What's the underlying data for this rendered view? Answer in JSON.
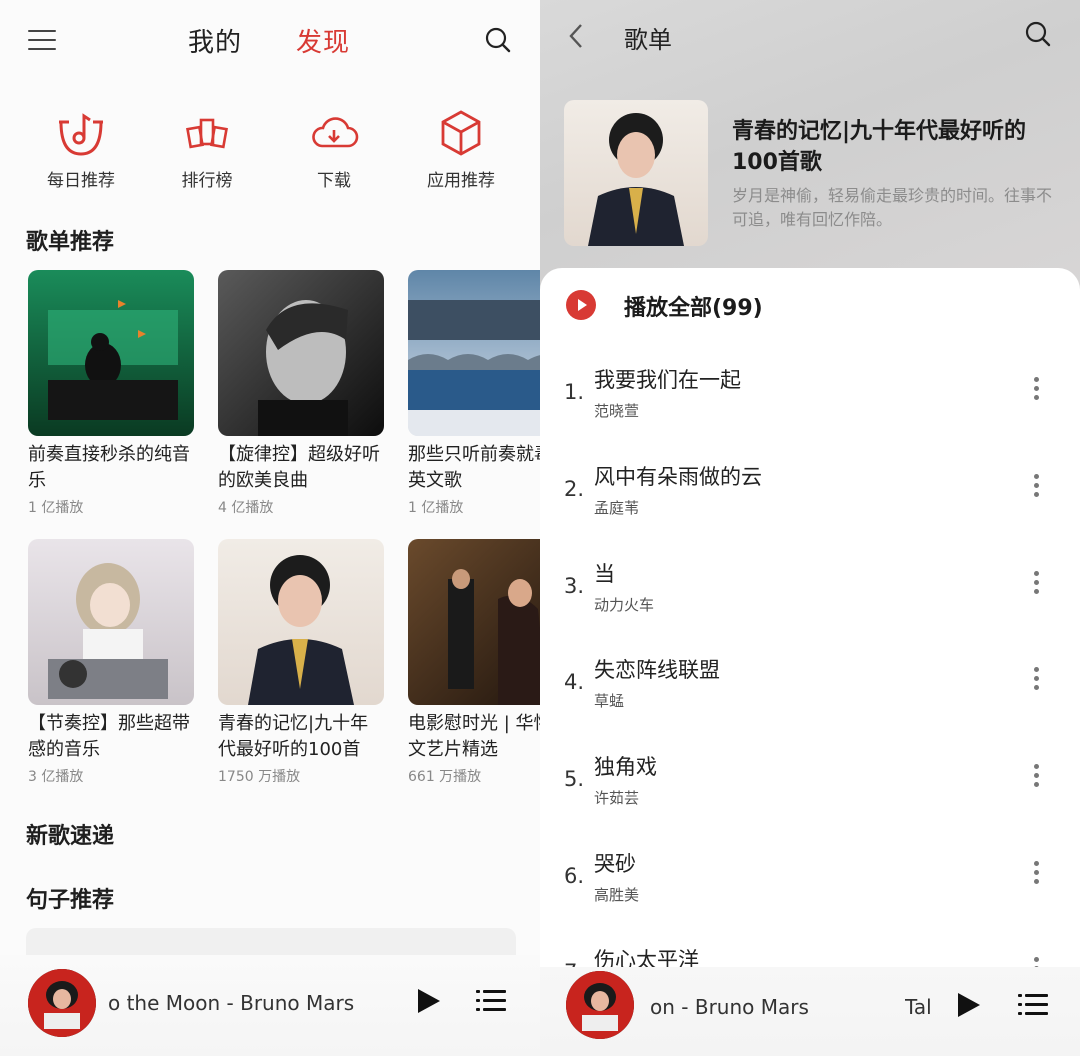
{
  "left": {
    "tabs": {
      "mine": "我的",
      "discover": "发现"
    },
    "shortcuts": [
      {
        "label": "每日推荐",
        "icon": "daily-recommend-icon"
      },
      {
        "label": "排行榜",
        "icon": "charts-icon"
      },
      {
        "label": "下载",
        "icon": "cloud-download-icon"
      },
      {
        "label": "应用推荐",
        "icon": "app-box-icon"
      }
    ],
    "sections": {
      "playlists": "歌单推荐",
      "new_songs": "新歌速递",
      "quotes": "句子推荐"
    },
    "cards": [
      {
        "name": "前奏直接秒杀的纯音乐",
        "plays": "1 亿播放"
      },
      {
        "name": "【旋律控】超级好听的欧美良曲",
        "plays": "4 亿播放"
      },
      {
        "name": "那些只听前奏就毒的英文歌",
        "plays": "1 亿播放"
      },
      {
        "name": "【节奏控】那些超带感的音乐",
        "plays": "3 亿播放"
      },
      {
        "name": "青春的记忆|九十年代最好听的100首",
        "plays": "1750 万播放"
      },
      {
        "name": "电影慰时光 | 华怀旧文艺片精选",
        "plays": "661 万播放"
      }
    ],
    "now_playing": "o the Moon - Bruno Mars"
  },
  "right": {
    "header_title": "歌单",
    "playlist_title": "青春的记忆|九十年代最好听的100首歌",
    "playlist_desc": "岁月是神偷，轻易偷走最珍贵的时间。往事不可追，唯有回忆作陪。",
    "play_all": "播放全部(99)",
    "songs": [
      {
        "idx": "1.",
        "title": "我要我们在一起",
        "artist": "范晓萱"
      },
      {
        "idx": "2.",
        "title": "风中有朵雨做的云",
        "artist": "孟庭苇"
      },
      {
        "idx": "3.",
        "title": "当",
        "artist": "动力火车"
      },
      {
        "idx": "4.",
        "title": "失恋阵线联盟",
        "artist": "草蜢"
      },
      {
        "idx": "5.",
        "title": "独角戏",
        "artist": "许茹芸"
      },
      {
        "idx": "6.",
        "title": "哭砂",
        "artist": "高胜美"
      },
      {
        "idx": "7.",
        "title": "伤心太平洋",
        "artist": ""
      }
    ],
    "now_playing": "on - Bruno Mars",
    "now_playing_next": "Tal"
  },
  "colors": {
    "accent": "#d83a34",
    "text": "#222222",
    "muted": "#888888"
  }
}
